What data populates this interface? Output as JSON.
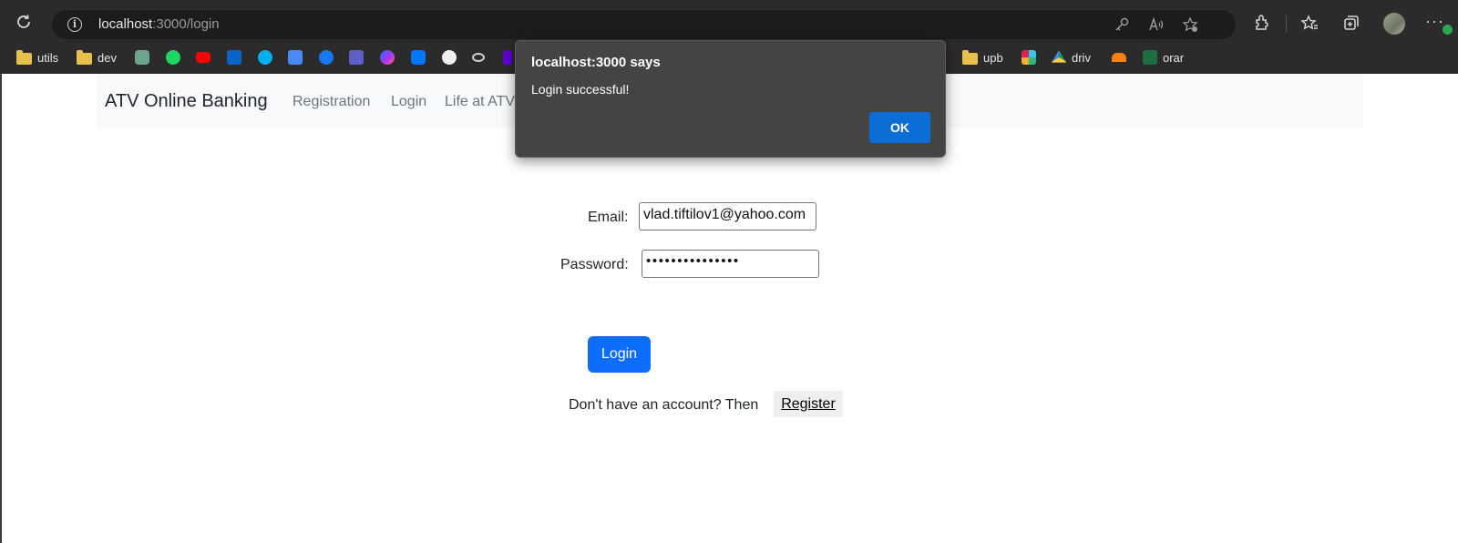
{
  "browser": {
    "url_host": "localhost",
    "url_path": ":3000/login",
    "bookmarks": [
      {
        "label": "utils",
        "icon": "folder-icon"
      },
      {
        "label": "dev",
        "icon": "folder-icon"
      },
      {
        "label": "",
        "icon": "chatgpt-icon"
      },
      {
        "label": "",
        "icon": "spotify-icon"
      },
      {
        "label": "",
        "icon": "youtube-icon"
      },
      {
        "label": "",
        "icon": "outlook-icon"
      },
      {
        "label": "",
        "icon": "skype-icon"
      },
      {
        "label": "",
        "icon": "google-translate-icon"
      },
      {
        "label": "",
        "icon": "facebook-icon"
      },
      {
        "label": "",
        "icon": "teams-icon"
      },
      {
        "label": "",
        "icon": "messenger-icon"
      },
      {
        "label": "",
        "icon": "vk-icon"
      },
      {
        "label": "",
        "icon": "github-icon"
      },
      {
        "label": "",
        "icon": "bee-icon"
      },
      {
        "label": "",
        "icon": "yahoo-icon"
      },
      {
        "label": "upb",
        "icon": "folder-icon"
      },
      {
        "label": "",
        "icon": "slack-icon"
      },
      {
        "label": "driv",
        "icon": "google-drive-icon"
      },
      {
        "label": "",
        "icon": "moodle-icon"
      },
      {
        "label": "orar",
        "icon": "excel-icon"
      }
    ]
  },
  "navbar": {
    "brand": "ATV Online Banking",
    "links": [
      "Registration",
      "Login",
      "Life at ATV"
    ]
  },
  "form": {
    "email_label": "Email:",
    "email_value": "vlad.tiftilov1@yahoo.com",
    "password_label": "Password:",
    "password_value": "•••••••••••••••",
    "login_button": "Login",
    "register_prompt": "Don't have an account? Then",
    "register_button": "Register"
  },
  "dialog": {
    "title": "localhost:3000 says",
    "message": "Login successful!",
    "ok_button": "OK"
  },
  "colors": {
    "primary": "#0d6efd",
    "dialog_bg": "#444444",
    "chrome_bg": "#2b2b2b"
  }
}
